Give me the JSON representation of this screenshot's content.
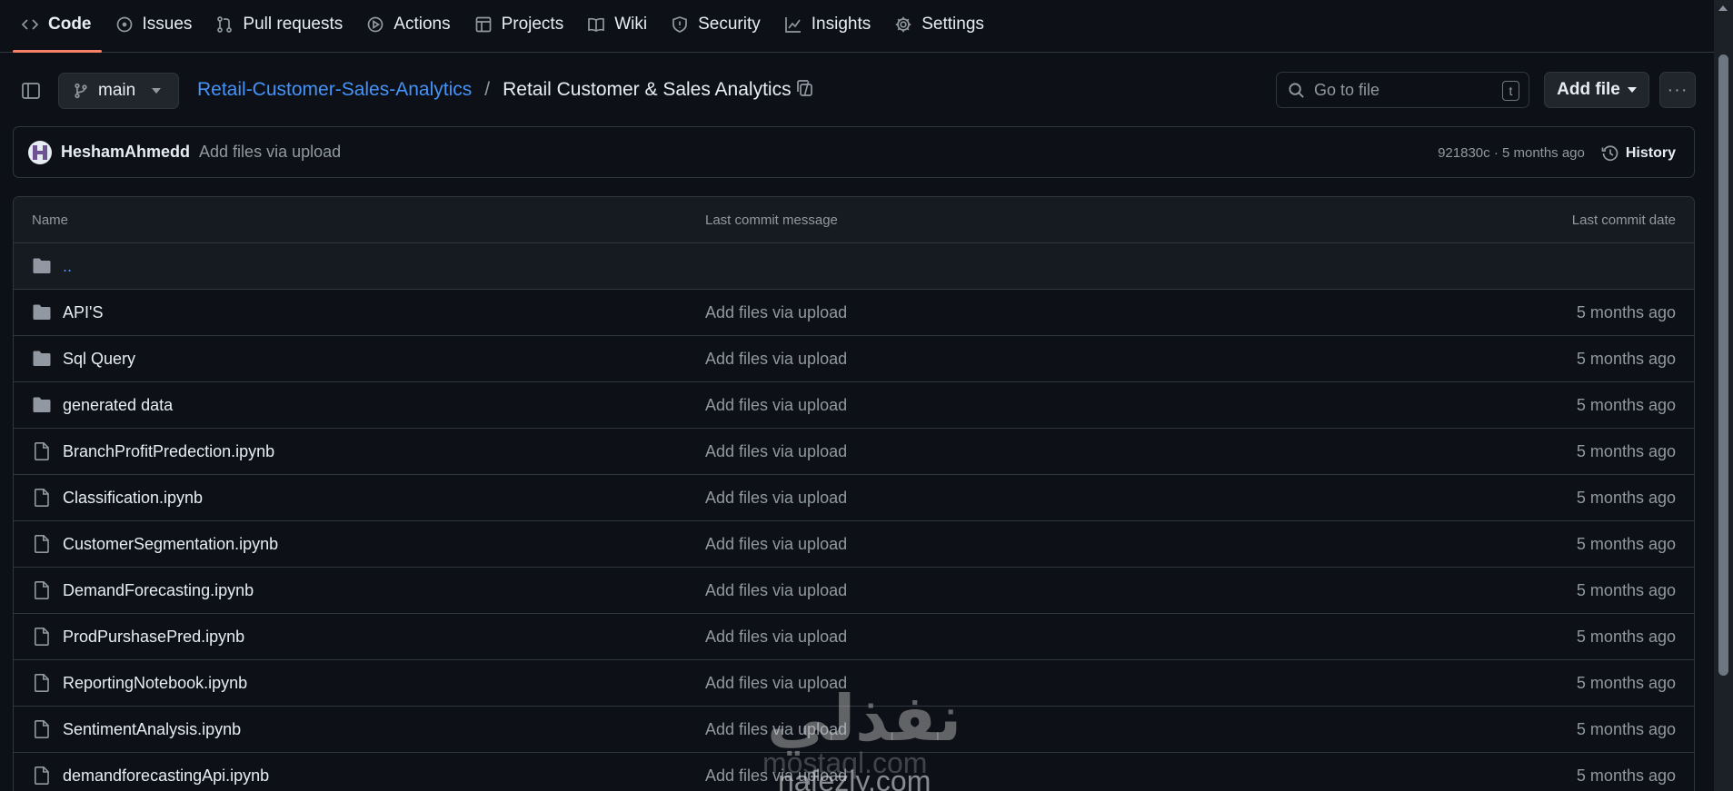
{
  "nav": {
    "tabs": [
      {
        "label": "Code",
        "icon": "code-icon",
        "active": true
      },
      {
        "label": "Issues",
        "icon": "issue-icon"
      },
      {
        "label": "Pull requests",
        "icon": "pull-request-icon"
      },
      {
        "label": "Actions",
        "icon": "play-icon"
      },
      {
        "label": "Projects",
        "icon": "table-icon"
      },
      {
        "label": "Wiki",
        "icon": "book-icon"
      },
      {
        "label": "Security",
        "icon": "shield-icon"
      },
      {
        "label": "Insights",
        "icon": "graph-icon"
      },
      {
        "label": "Settings",
        "icon": "gear-icon"
      }
    ]
  },
  "branch": {
    "name": "main"
  },
  "breadcrumb": {
    "repo": "Retail-Customer-Sales-Analytics",
    "separator": "/",
    "folder": "Retail Customer & Sales Analytics",
    "trailing_separator": "/"
  },
  "search": {
    "placeholder": "Go to file",
    "shortcut": "t"
  },
  "toolbar": {
    "add_file_label": "Add file",
    "more_label": "···"
  },
  "commit": {
    "author": "HeshamAhmedd",
    "message": "Add files via upload",
    "meta": "921830c · 5 months ago",
    "history_label": "History"
  },
  "table": {
    "headers": {
      "name": "Name",
      "message": "Last commit message",
      "date": "Last commit date"
    },
    "parent_label": "..",
    "rows": [
      {
        "name": "API'S",
        "type": "folder",
        "message": "Add files via upload",
        "date": "5 months ago"
      },
      {
        "name": "Sql Query",
        "type": "folder",
        "message": "Add files via upload",
        "date": "5 months ago"
      },
      {
        "name": "generated data",
        "type": "folder",
        "message": "Add files via upload",
        "date": "5 months ago"
      },
      {
        "name": "BranchProfitPredection.ipynb",
        "type": "file",
        "message": "Add files via upload",
        "date": "5 months ago"
      },
      {
        "name": "Classification.ipynb",
        "type": "file",
        "message": "Add files via upload",
        "date": "5 months ago"
      },
      {
        "name": "CustomerSegmentation.ipynb",
        "type": "file",
        "message": "Add files via upload",
        "date": "5 months ago"
      },
      {
        "name": "DemandForecasting.ipynb",
        "type": "file",
        "message": "Add files via upload",
        "date": "5 months ago"
      },
      {
        "name": "ProdPurshasePred.ipynb",
        "type": "file",
        "message": "Add files via upload",
        "date": "5 months ago"
      },
      {
        "name": "ReportingNotebook.ipynb",
        "type": "file",
        "message": "Add files via upload",
        "date": "5 months ago"
      },
      {
        "name": "SentimentAnalysis.ipynb",
        "type": "file",
        "message": "Add files via upload",
        "date": "5 months ago"
      },
      {
        "name": "demandforecastingApi.ipynb",
        "type": "file",
        "message": "Add files via upload",
        "date": "5 months ago"
      }
    ]
  },
  "watermark": {
    "arabic": "نفذلي",
    "line1": "mostaql.com",
    "line2": "nafezly.com"
  },
  "colors": {
    "background": "#0d1117",
    "link": "#4493f8",
    "active_tab": "#f78166",
    "border": "#30363d",
    "muted": "#9198a1"
  }
}
